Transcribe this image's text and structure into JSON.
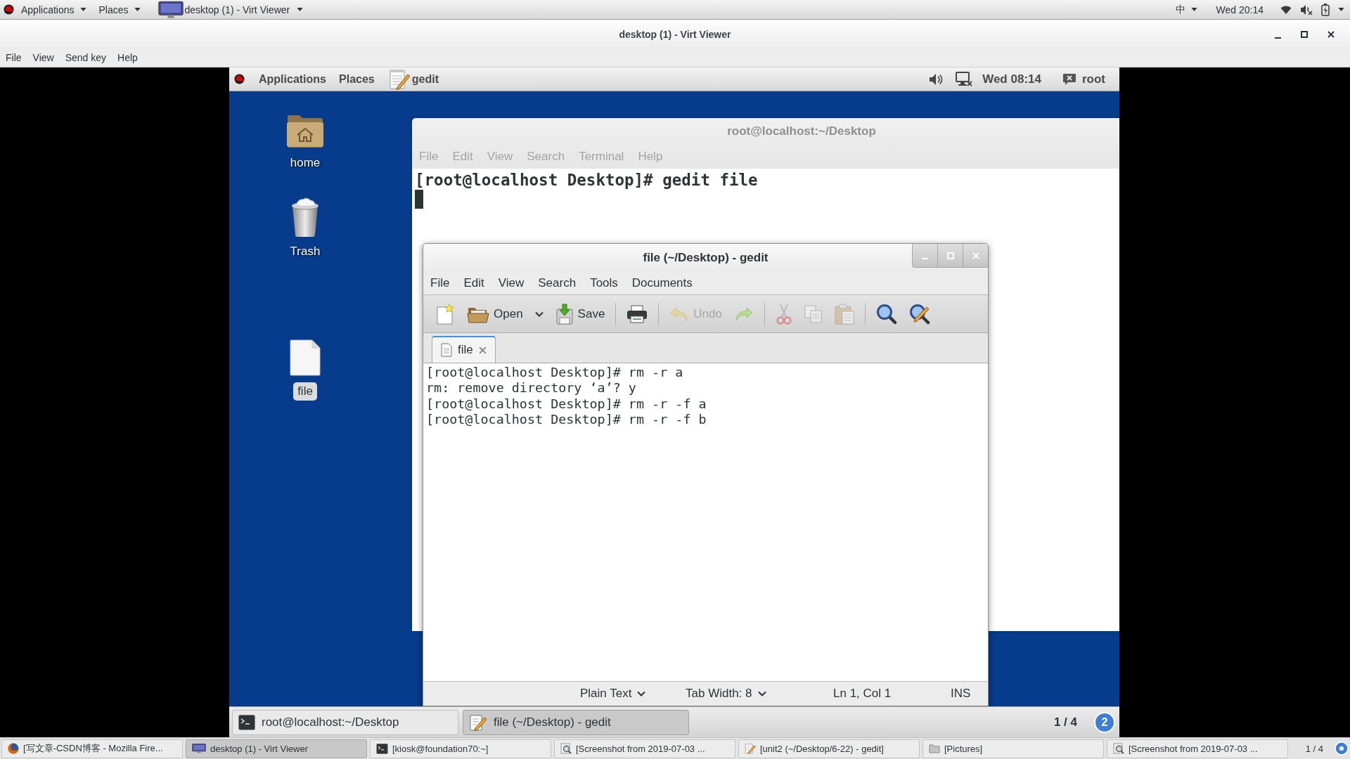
{
  "host_top_bar": {
    "menus": [
      "Applications",
      "Places"
    ],
    "window_menu": "desktop (1) - Virt Viewer",
    "input_method": "中",
    "clock": "Wed 20:14"
  },
  "window": {
    "title": "desktop (1) - Virt Viewer",
    "menu": [
      "File",
      "View",
      "Send key",
      "Help"
    ]
  },
  "guest": {
    "top_bar": {
      "menus": [
        "Applications",
        "Places"
      ],
      "app": "gedit",
      "clock": "Wed 08:14",
      "user": "root"
    },
    "desktop_icons": [
      {
        "kind": "home",
        "label": "home",
        "selected": false
      },
      {
        "kind": "trash",
        "label": "Trash",
        "selected": false
      },
      {
        "kind": "file",
        "label": "file",
        "selected": true
      }
    ],
    "terminal": {
      "title": "root@localhost:~/Desktop",
      "menu": [
        "File",
        "Edit",
        "View",
        "Search",
        "Terminal",
        "Help"
      ],
      "lines": [
        "[root@localhost Desktop]# gedit file"
      ]
    },
    "gedit": {
      "title": "file (~/Desktop) - gedit",
      "menu": [
        "File",
        "Edit",
        "View",
        "Search",
        "Tools",
        "Documents"
      ],
      "toolbar": [
        {
          "kind": "new",
          "disabled": false
        },
        {
          "kind": "open",
          "label": "Open",
          "disabled": false
        },
        {
          "kind": "dropdown",
          "disabled": false
        },
        {
          "kind": "save",
          "label": "Save",
          "disabled": false
        },
        {
          "kind": "separator"
        },
        {
          "kind": "print",
          "disabled": false
        },
        {
          "kind": "separator"
        },
        {
          "kind": "undo",
          "label": "Undo",
          "disabled": true
        },
        {
          "kind": "redo",
          "disabled": true
        },
        {
          "kind": "separator"
        },
        {
          "kind": "cut",
          "disabled": true
        },
        {
          "kind": "copy",
          "disabled": true
        },
        {
          "kind": "paste",
          "disabled": true
        },
        {
          "kind": "separator"
        },
        {
          "kind": "find",
          "disabled": false
        },
        {
          "kind": "replace",
          "disabled": false
        }
      ],
      "tabs": [
        {
          "label": "file",
          "selected": true
        }
      ],
      "lines": [
        "[root@localhost Desktop]# rm -r a",
        "rm: remove directory ‘a’? y",
        "[root@localhost Desktop]# rm -r -f a",
        "[root@localhost Desktop]# rm -r -f b"
      ],
      "status": {
        "language": "Plain Text",
        "tab_width": "Tab Width: 8",
        "position": "Ln 1, Col 1",
        "mode": "INS"
      }
    },
    "taskbar": {
      "items": [
        {
          "kind": "terminal",
          "label": "root@localhost:~/Desktop",
          "selected": false
        },
        {
          "kind": "editor",
          "label": "file (~/Desktop) - gedit",
          "selected": true
        }
      ],
      "workspace": "1 / 4",
      "notifications": "2"
    }
  },
  "host_taskbar": {
    "items": [
      {
        "kind": "browser",
        "label": "[写文章-CSDN博客 - Mozilla Fire...",
        "selected": false
      },
      {
        "kind": "viewer",
        "label": "desktop (1) - Virt Viewer",
        "selected": true
      },
      {
        "kind": "terminal",
        "label": "[kiosk@foundation70:~]",
        "selected": false
      },
      {
        "kind": "screenshot",
        "label": "[Screenshot from 2019-07-03 ...",
        "selected": false
      },
      {
        "kind": "editor",
        "label": "[unit2 (~/Desktop/6-22) - gedit]",
        "selected": false
      },
      {
        "kind": "folder",
        "label": "[Pictures]",
        "selected": false
      },
      {
        "kind": "screenshot",
        "label": "[Screenshot from 2019-07-03 ...",
        "selected": false
      }
    ],
    "workspace": "1 / 4"
  }
}
